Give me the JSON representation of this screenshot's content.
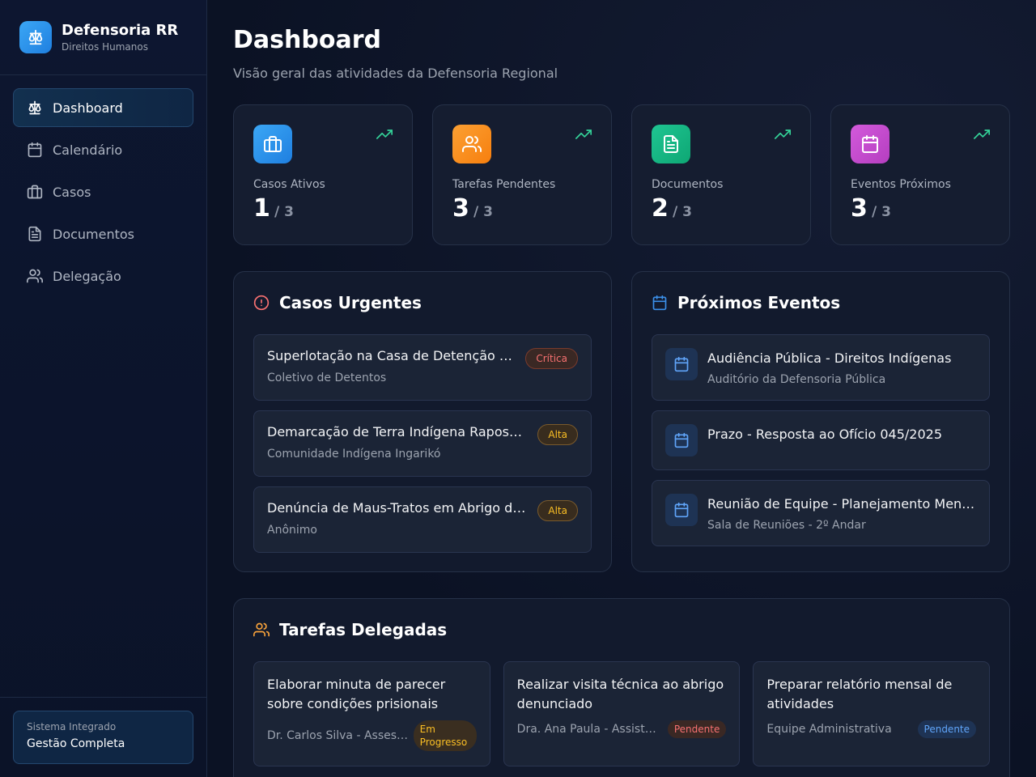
{
  "brand": {
    "title": "Defensoria RR",
    "subtitle": "Direitos Humanos",
    "icon": "scale-icon"
  },
  "nav": [
    {
      "label": "Dashboard",
      "icon": "scale-icon",
      "active": true
    },
    {
      "label": "Calendário",
      "icon": "calendar-icon"
    },
    {
      "label": "Casos",
      "icon": "briefcase-icon"
    },
    {
      "label": "Documentos",
      "icon": "document-icon"
    },
    {
      "label": "Delegação",
      "icon": "users-icon"
    }
  ],
  "footer": {
    "small": "Sistema Integrado",
    "main": "Gestão Completa"
  },
  "page": {
    "title": "Dashboard",
    "subtitle": "Visão geral das atividades da Defensoria Regional"
  },
  "stats": [
    {
      "label": "Casos Ativos",
      "value": "1",
      "total": "/ 3",
      "color": "#2f8fe8",
      "icon": "briefcase-icon"
    },
    {
      "label": "Tarefas Pendentes",
      "value": "3",
      "total": "/ 3",
      "color": "#f7931e",
      "icon": "users-icon"
    },
    {
      "label": "Documentos",
      "value": "2",
      "total": "/ 3",
      "color": "#10b981",
      "icon": "document-icon"
    },
    {
      "label": "Eventos Próximos",
      "value": "3",
      "total": "/ 3",
      "color": "#c84bd1",
      "icon": "calendar-icon"
    }
  ],
  "urgent": {
    "title": "Casos Urgentes",
    "items": [
      {
        "title": "Superlotação na Casa de Detenção de Boa Vista",
        "sub": "Coletivo de Detentos",
        "badge": "Crítica"
      },
      {
        "title": "Demarcação de Terra Indígena Raposa Serra do Sol",
        "sub": "Comunidade Indígena Ingarikó",
        "badge": "Alta"
      },
      {
        "title": "Denúncia de Maus-Tratos em Abrigo de Idosos",
        "sub": "Anônimo",
        "badge": "Alta"
      }
    ]
  },
  "events": {
    "title": "Próximos Eventos",
    "items": [
      {
        "title": "Audiência Pública - Direitos Indígenas",
        "sub": "Auditório da Defensoria Pública"
      },
      {
        "title": "Prazo - Resposta ao Ofício 045/2025",
        "sub": ""
      },
      {
        "title": "Reunião de Equipe - Planejamento Mensal",
        "sub": "Sala de Reuniões - 2º Andar"
      }
    ]
  },
  "tasks": {
    "title": "Tarefas Delegadas",
    "items": [
      {
        "title": "Elaborar minuta de parecer sobre condições prisionais",
        "who": "Dr. Carlos Silva - Assessor Jurídico",
        "badge": "Em Progresso"
      },
      {
        "title": "Realizar visita técnica ao abrigo denunciado",
        "who": "Dra. Ana Paula - Assistente Social",
        "badge": "Pendente"
      },
      {
        "title": "Preparar relatório mensal de atividades",
        "who": "Equipe Administrativa",
        "badge": "Pendente"
      }
    ]
  },
  "colors": {
    "accent": "#2f8fe8",
    "critical": "#f87171",
    "high": "#fbbf24",
    "trend": "#34d399"
  }
}
